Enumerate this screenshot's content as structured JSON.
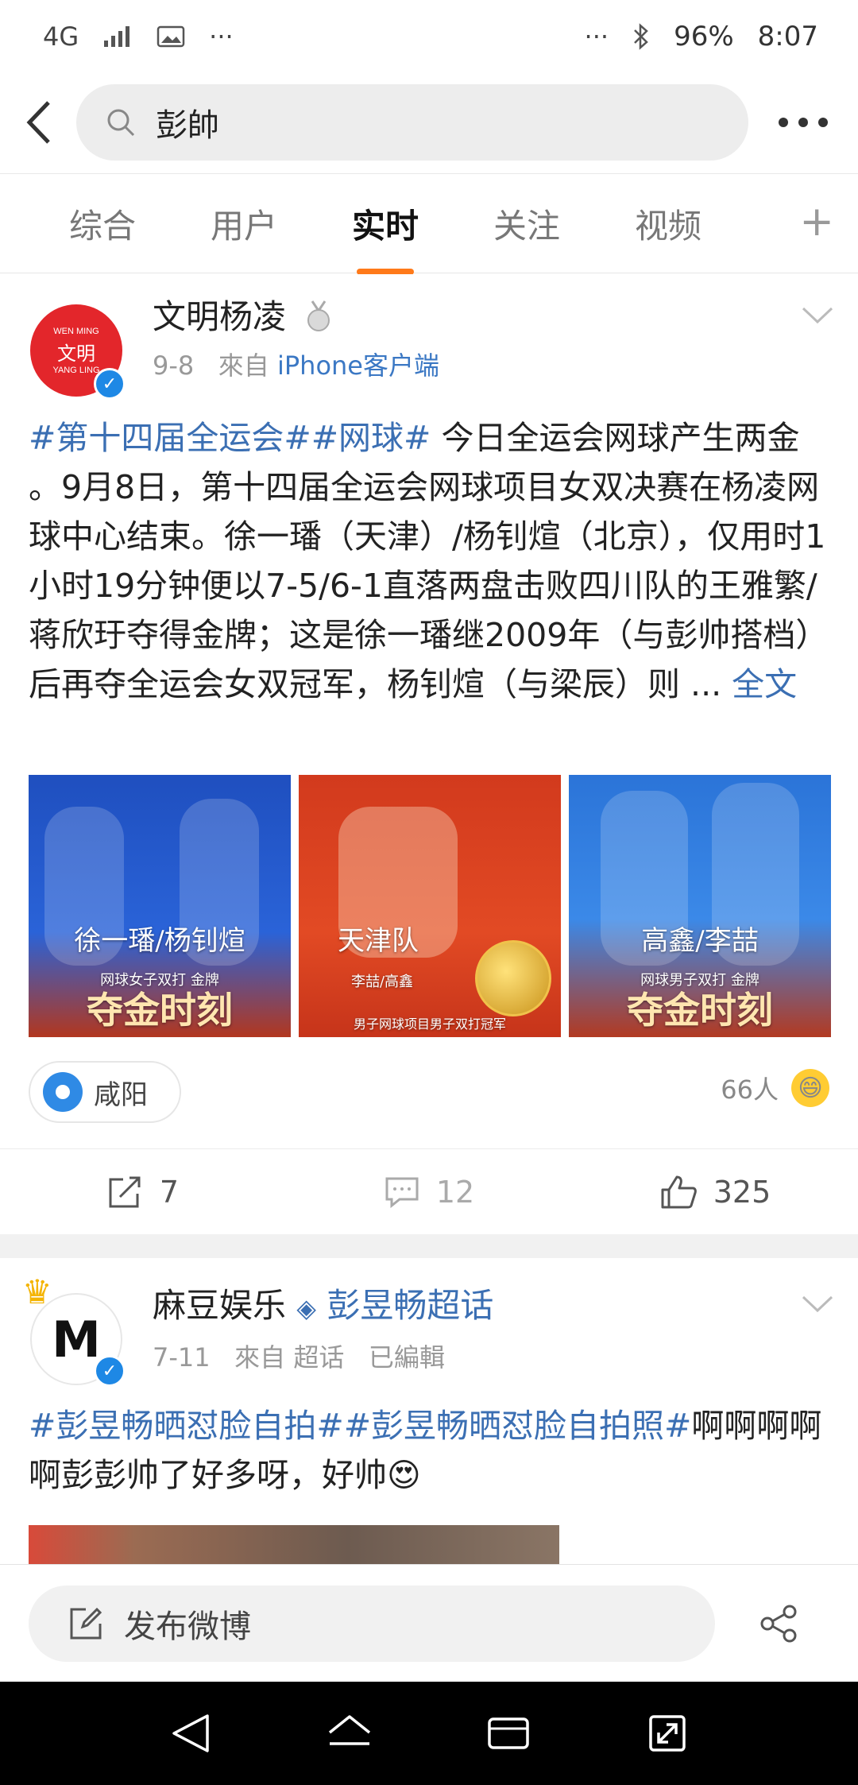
{
  "status_bar": {
    "network": "4G",
    "battery": "96%",
    "time": "8:07",
    "dots_left": "···",
    "dots_right": "···"
  },
  "search": {
    "query": "彭帥"
  },
  "tabs": [
    {
      "label": "综合",
      "active": false
    },
    {
      "label": "用户",
      "active": false
    },
    {
      "label": "实时",
      "active": true
    },
    {
      "label": "关注",
      "active": false
    },
    {
      "label": "视频",
      "active": false
    }
  ],
  "post1": {
    "author": "文明杨凌",
    "date": "9-8",
    "from_label": "來自",
    "source": "iPhone客户端",
    "tags": "#第十四届全运会##网球#",
    "body": " 今日全运会网球产生两金 。9月8日，第十四届全运会网球项目女双决赛在杨凌网球中心结束。徐一璠（天津）/杨钊煊（北京），仅用时1小时19分钟便以7-5/6-1直落两盘击败四川队的王雅繁/蒋欣玗夺得金牌；这是徐一璠继2009年（与彭帅搭档）后再夺全运会女双冠军，杨钊煊（与梁辰）则 ... ",
    "full_text": "全文",
    "images": [
      {
        "caption": "徐一璠/杨钊煊",
        "sub": "网球女子双打 金牌",
        "banner": "夺金时刻"
      },
      {
        "caption": "天津队",
        "sub": "李喆/高鑫",
        "banner": "男子网球项目男子双打冠军"
      },
      {
        "caption": "高鑫/李喆",
        "sub": "网球男子双打 金牌",
        "banner": "夺金时刻"
      }
    ],
    "location": "咸阳",
    "likers": "66人",
    "reposts": "7",
    "comments": "12",
    "likes": "325"
  },
  "post2": {
    "author": "麻豆娱乐",
    "supertopic": "彭昱畅超话",
    "date": "7-11",
    "from_label": "來自",
    "source": "超话",
    "edited": "已編輯",
    "tags": "#彭昱畅晒怼脸自拍##彭昱畅晒怼脸自拍照#",
    "body": "啊啊啊啊啊彭彭帅了好多呀，好帅"
  },
  "compose": {
    "placeholder": "发布微博"
  },
  "colors": {
    "accent": "#ff7a1a",
    "link": "#3b6fb3",
    "verified": "#1e88e5"
  }
}
